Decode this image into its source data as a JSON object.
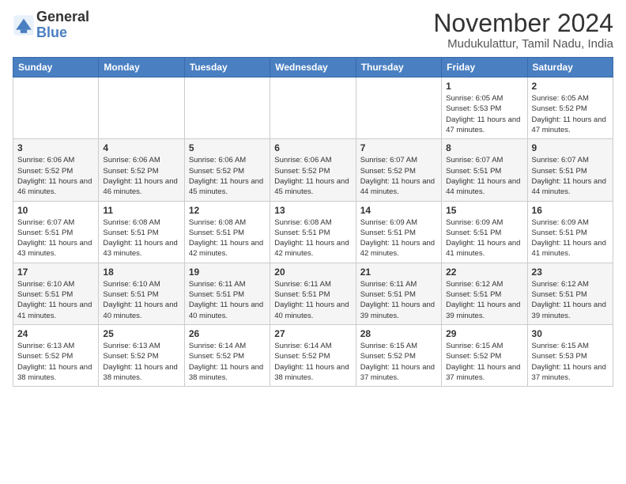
{
  "logo": {
    "name_part1": "General",
    "name_part2": "Blue"
  },
  "header": {
    "month_year": "November 2024",
    "location": "Mudukulattur, Tamil Nadu, India"
  },
  "days_of_week": [
    "Sunday",
    "Monday",
    "Tuesday",
    "Wednesday",
    "Thursday",
    "Friday",
    "Saturday"
  ],
  "weeks": [
    [
      {
        "day": "",
        "info": ""
      },
      {
        "day": "",
        "info": ""
      },
      {
        "day": "",
        "info": ""
      },
      {
        "day": "",
        "info": ""
      },
      {
        "day": "",
        "info": ""
      },
      {
        "day": "1",
        "info": "Sunrise: 6:05 AM\nSunset: 5:53 PM\nDaylight: 11 hours and 47 minutes."
      },
      {
        "day": "2",
        "info": "Sunrise: 6:05 AM\nSunset: 5:52 PM\nDaylight: 11 hours and 47 minutes."
      }
    ],
    [
      {
        "day": "3",
        "info": "Sunrise: 6:06 AM\nSunset: 5:52 PM\nDaylight: 11 hours and 46 minutes."
      },
      {
        "day": "4",
        "info": "Sunrise: 6:06 AM\nSunset: 5:52 PM\nDaylight: 11 hours and 46 minutes."
      },
      {
        "day": "5",
        "info": "Sunrise: 6:06 AM\nSunset: 5:52 PM\nDaylight: 11 hours and 45 minutes."
      },
      {
        "day": "6",
        "info": "Sunrise: 6:06 AM\nSunset: 5:52 PM\nDaylight: 11 hours and 45 minutes."
      },
      {
        "day": "7",
        "info": "Sunrise: 6:07 AM\nSunset: 5:52 PM\nDaylight: 11 hours and 44 minutes."
      },
      {
        "day": "8",
        "info": "Sunrise: 6:07 AM\nSunset: 5:51 PM\nDaylight: 11 hours and 44 minutes."
      },
      {
        "day": "9",
        "info": "Sunrise: 6:07 AM\nSunset: 5:51 PM\nDaylight: 11 hours and 44 minutes."
      }
    ],
    [
      {
        "day": "10",
        "info": "Sunrise: 6:07 AM\nSunset: 5:51 PM\nDaylight: 11 hours and 43 minutes."
      },
      {
        "day": "11",
        "info": "Sunrise: 6:08 AM\nSunset: 5:51 PM\nDaylight: 11 hours and 43 minutes."
      },
      {
        "day": "12",
        "info": "Sunrise: 6:08 AM\nSunset: 5:51 PM\nDaylight: 11 hours and 42 minutes."
      },
      {
        "day": "13",
        "info": "Sunrise: 6:08 AM\nSunset: 5:51 PM\nDaylight: 11 hours and 42 minutes."
      },
      {
        "day": "14",
        "info": "Sunrise: 6:09 AM\nSunset: 5:51 PM\nDaylight: 11 hours and 42 minutes."
      },
      {
        "day": "15",
        "info": "Sunrise: 6:09 AM\nSunset: 5:51 PM\nDaylight: 11 hours and 41 minutes."
      },
      {
        "day": "16",
        "info": "Sunrise: 6:09 AM\nSunset: 5:51 PM\nDaylight: 11 hours and 41 minutes."
      }
    ],
    [
      {
        "day": "17",
        "info": "Sunrise: 6:10 AM\nSunset: 5:51 PM\nDaylight: 11 hours and 41 minutes."
      },
      {
        "day": "18",
        "info": "Sunrise: 6:10 AM\nSunset: 5:51 PM\nDaylight: 11 hours and 40 minutes."
      },
      {
        "day": "19",
        "info": "Sunrise: 6:11 AM\nSunset: 5:51 PM\nDaylight: 11 hours and 40 minutes."
      },
      {
        "day": "20",
        "info": "Sunrise: 6:11 AM\nSunset: 5:51 PM\nDaylight: 11 hours and 40 minutes."
      },
      {
        "day": "21",
        "info": "Sunrise: 6:11 AM\nSunset: 5:51 PM\nDaylight: 11 hours and 39 minutes."
      },
      {
        "day": "22",
        "info": "Sunrise: 6:12 AM\nSunset: 5:51 PM\nDaylight: 11 hours and 39 minutes."
      },
      {
        "day": "23",
        "info": "Sunrise: 6:12 AM\nSunset: 5:51 PM\nDaylight: 11 hours and 39 minutes."
      }
    ],
    [
      {
        "day": "24",
        "info": "Sunrise: 6:13 AM\nSunset: 5:52 PM\nDaylight: 11 hours and 38 minutes."
      },
      {
        "day": "25",
        "info": "Sunrise: 6:13 AM\nSunset: 5:52 PM\nDaylight: 11 hours and 38 minutes."
      },
      {
        "day": "26",
        "info": "Sunrise: 6:14 AM\nSunset: 5:52 PM\nDaylight: 11 hours and 38 minutes."
      },
      {
        "day": "27",
        "info": "Sunrise: 6:14 AM\nSunset: 5:52 PM\nDaylight: 11 hours and 38 minutes."
      },
      {
        "day": "28",
        "info": "Sunrise: 6:15 AM\nSunset: 5:52 PM\nDaylight: 11 hours and 37 minutes."
      },
      {
        "day": "29",
        "info": "Sunrise: 6:15 AM\nSunset: 5:52 PM\nDaylight: 11 hours and 37 minutes."
      },
      {
        "day": "30",
        "info": "Sunrise: 6:15 AM\nSunset: 5:53 PM\nDaylight: 11 hours and 37 minutes."
      }
    ]
  ]
}
